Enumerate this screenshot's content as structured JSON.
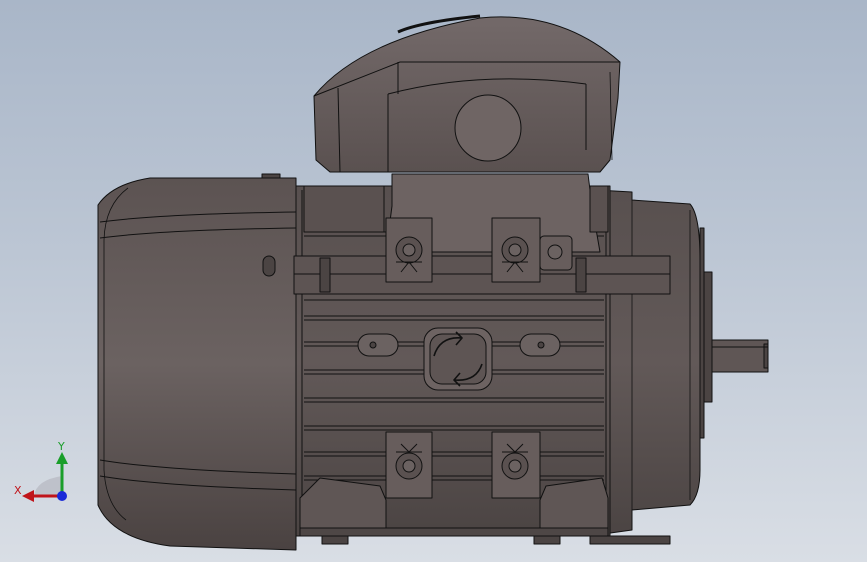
{
  "viewport": {
    "model": "electric-motor",
    "view": "front"
  },
  "triad": {
    "x_label": "X",
    "y_label": "Y",
    "x_color": "#c0141a",
    "y_color": "#1a9e2a",
    "z_color": "#1a2ad8"
  },
  "colors": {
    "body": "#5a5150",
    "body_light": "#6c6261",
    "body_dark": "#463f3e",
    "edge": "#111111"
  }
}
